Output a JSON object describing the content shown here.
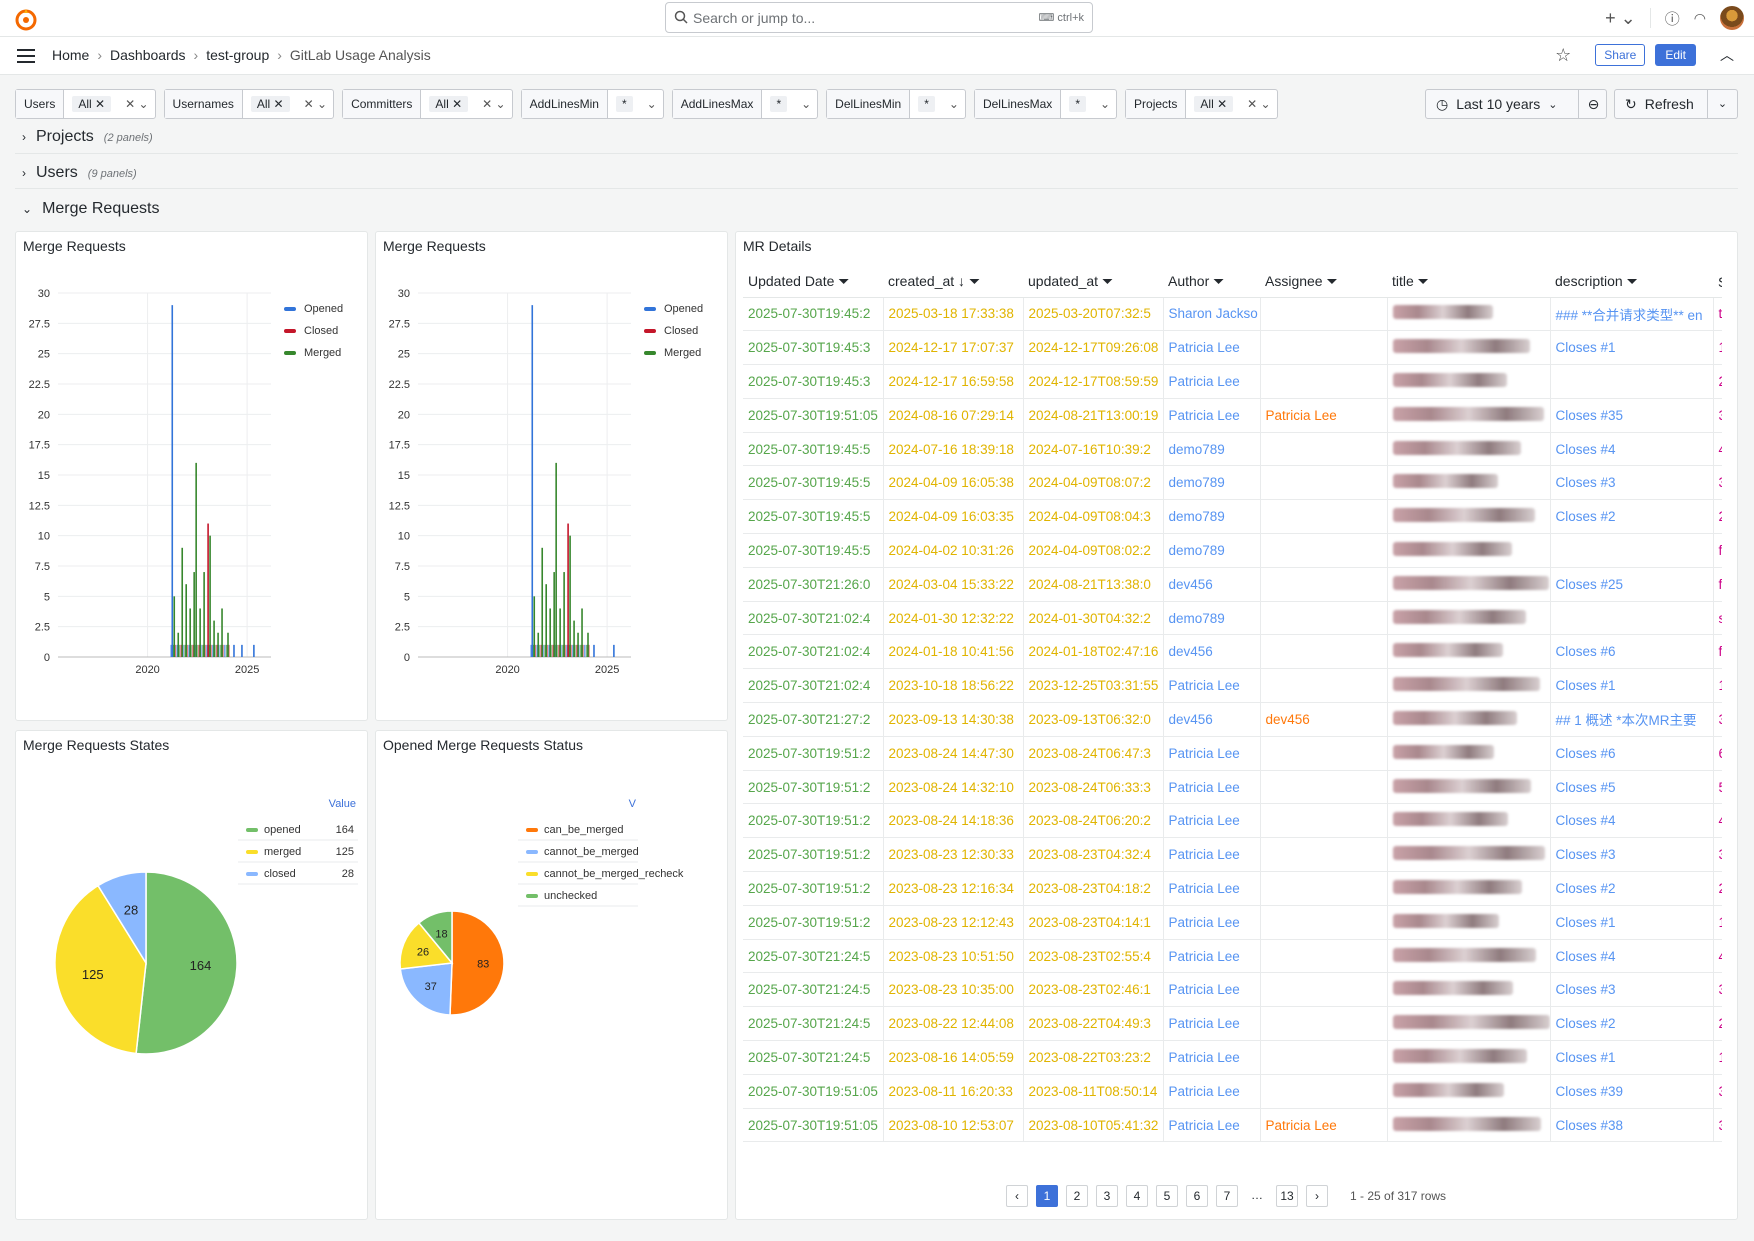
{
  "search": {
    "placeholder": "Search or jump to...",
    "shortcut": "ctrl+k"
  },
  "breadcrumbs": [
    "Home",
    "Dashboards",
    "test-group",
    "GitLab Usage Analysis"
  ],
  "toolbar": {
    "share": "Share",
    "edit": "Edit"
  },
  "variables": [
    {
      "label": "Users",
      "value": "All",
      "clearable": true
    },
    {
      "label": "Usernames",
      "value": "All",
      "clearable": true
    },
    {
      "label": "Committers",
      "value": "All",
      "clearable": true
    },
    {
      "label": "AddLinesMin",
      "value": "*",
      "clearable": false
    },
    {
      "label": "AddLinesMax",
      "value": "*",
      "clearable": false
    },
    {
      "label": "DelLinesMin",
      "value": "*",
      "clearable": false
    },
    {
      "label": "DelLinesMax",
      "value": "*",
      "clearable": false
    },
    {
      "label": "Projects",
      "value": "All",
      "clearable": true
    }
  ],
  "time": {
    "label": "Last 10 years",
    "refresh": "Refresh"
  },
  "rows": [
    {
      "title": "Projects",
      "count": "(2 panels)",
      "collapsed": true
    },
    {
      "title": "Users",
      "count": "(9 panels)",
      "collapsed": true
    },
    {
      "title": "Merge Requests",
      "collapsed": false
    }
  ],
  "panels": {
    "mr1": {
      "title": "Merge Requests"
    },
    "mr2": {
      "title": "Merge Requests"
    },
    "states": {
      "title": "Merge Requests States",
      "value_header": "Value"
    },
    "opened": {
      "title": "Opened Merge Requests Status",
      "value_header": "V"
    },
    "details": {
      "title": "MR Details"
    }
  },
  "colors": {
    "opened": "#3274d9",
    "closed": "#c4162a",
    "merged": "#37872d",
    "pie_green": "#73bf69",
    "pie_yellow": "#fade2a",
    "pie_blue": "#8ab8ff",
    "pie_orange": "#ff780a"
  },
  "chart_data": [
    {
      "type": "bar",
      "title": "Merge Requests",
      "series": [
        {
          "name": "Opened"
        },
        {
          "name": "Closed"
        },
        {
          "name": "Merged"
        }
      ],
      "yticks": [
        "0",
        "2.5",
        "5",
        "7.5",
        "10",
        "12.5",
        "15",
        "17.5",
        "20",
        "22.5",
        "25",
        "27.5",
        "30"
      ],
      "xticks": [
        "2020",
        "2025"
      ],
      "ylim": [
        0,
        30
      ],
      "bars": [
        {
          "x": 2021.2,
          "series": "Opened",
          "y": 29
        },
        {
          "x": 2021.3,
          "series": "Merged",
          "y": 5
        },
        {
          "x": 2021.5,
          "series": "Merged",
          "y": 2
        },
        {
          "x": 2021.7,
          "series": "Merged",
          "y": 9
        },
        {
          "x": 2021.9,
          "series": "Merged",
          "y": 6
        },
        {
          "x": 2022.1,
          "series": "Merged",
          "y": 4
        },
        {
          "x": 2022.3,
          "series": "Merged",
          "y": 7
        },
        {
          "x": 2022.4,
          "series": "Merged",
          "y": 16
        },
        {
          "x": 2022.6,
          "series": "Merged",
          "y": 4
        },
        {
          "x": 2022.8,
          "series": "Merged",
          "y": 7
        },
        {
          "x": 2023.0,
          "series": "Closed",
          "y": 11
        },
        {
          "x": 2023.1,
          "series": "Merged",
          "y": 10
        },
        {
          "x": 2023.3,
          "series": "Merged",
          "y": 3
        },
        {
          "x": 2023.5,
          "series": "Merged",
          "y": 2
        },
        {
          "x": 2023.7,
          "series": "Merged",
          "y": 4
        },
        {
          "x": 2024.0,
          "series": "Merged",
          "y": 2
        },
        {
          "x": 2024.3,
          "series": "Opened",
          "y": 1
        },
        {
          "x": 2024.7,
          "series": "Opened",
          "y": 1
        },
        {
          "x": 2025.3,
          "series": "Opened",
          "y": 1
        }
      ]
    },
    {
      "type": "bar",
      "title": "Merge Requests",
      "series": [
        {
          "name": "Opened"
        },
        {
          "name": "Closed"
        },
        {
          "name": "Merged"
        }
      ],
      "yticks": [
        "0",
        "2.5",
        "5",
        "7.5",
        "10",
        "12.5",
        "15",
        "17.5",
        "20",
        "22.5",
        "25",
        "27.5",
        "30"
      ],
      "xticks": [
        "2020",
        "2025"
      ],
      "ylim": [
        0,
        30
      ],
      "bars": [
        {
          "x": 2021.2,
          "series": "Opened",
          "y": 29
        },
        {
          "x": 2021.3,
          "series": "Merged",
          "y": 5
        },
        {
          "x": 2021.5,
          "series": "Merged",
          "y": 2
        },
        {
          "x": 2021.7,
          "series": "Merged",
          "y": 9
        },
        {
          "x": 2021.9,
          "series": "Merged",
          "y": 6
        },
        {
          "x": 2022.1,
          "series": "Merged",
          "y": 4
        },
        {
          "x": 2022.3,
          "series": "Merged",
          "y": 7
        },
        {
          "x": 2022.4,
          "series": "Merged",
          "y": 16
        },
        {
          "x": 2022.6,
          "series": "Merged",
          "y": 4
        },
        {
          "x": 2022.8,
          "series": "Merged",
          "y": 7
        },
        {
          "x": 2023.0,
          "series": "Closed",
          "y": 11
        },
        {
          "x": 2023.1,
          "series": "Merged",
          "y": 10
        },
        {
          "x": 2023.3,
          "series": "Merged",
          "y": 3
        },
        {
          "x": 2023.5,
          "series": "Merged",
          "y": 2
        },
        {
          "x": 2023.7,
          "series": "Merged",
          "y": 4
        },
        {
          "x": 2024.0,
          "series": "Merged",
          "y": 2
        },
        {
          "x": 2024.3,
          "series": "Opened",
          "y": 1
        },
        {
          "x": 2025.3,
          "series": "Opened",
          "y": 1
        }
      ]
    },
    {
      "type": "pie",
      "title": "Merge Requests States",
      "slices": [
        {
          "label": "opened",
          "value": 164
        },
        {
          "label": "merged",
          "value": 125
        },
        {
          "label": "closed",
          "value": 28
        }
      ]
    },
    {
      "type": "pie",
      "title": "Opened Merge Requests Status",
      "slices": [
        {
          "label": "can_be_merged",
          "value": 83
        },
        {
          "label": "cannot_be_merged",
          "value": 37
        },
        {
          "label": "cannot_be_merged_recheck",
          "value": 26
        },
        {
          "label": "unchecked",
          "value": 18
        }
      ]
    }
  ],
  "table": {
    "headers": [
      "Updated Date",
      "created_at",
      "updated_at",
      "Author",
      "Assignee",
      "title",
      "description",
      "S"
    ],
    "rows": [
      [
        "2025-07-30T19:45:2",
        "2025-03-18 17:33:38",
        "2025-03-20T07:32:5",
        "Sharon Jackso",
        "",
        "",
        "### **合并请求类型** en",
        "t"
      ],
      [
        "2025-07-30T19:45:3",
        "2024-12-17 17:07:37",
        "2024-12-17T09:26:08",
        "Patricia Lee",
        "",
        "",
        "Closes #1",
        "1"
      ],
      [
        "2025-07-30T19:45:3",
        "2024-12-17 16:59:58",
        "2024-12-17T08:59:59",
        "Patricia Lee",
        "",
        "",
        "",
        "2"
      ],
      [
        "2025-07-30T19:51:05",
        "2024-08-16 07:29:14",
        "2024-08-21T13:00:19",
        "Patricia Lee",
        "Patricia Lee",
        "",
        "Closes #35",
        "3"
      ],
      [
        "2025-07-30T19:45:5",
        "2024-07-16 18:39:18",
        "2024-07-16T10:39:2",
        "demo789",
        "",
        "",
        "Closes #4",
        "4"
      ],
      [
        "2025-07-30T19:45:5",
        "2024-04-09 16:05:38",
        "2024-04-09T08:07:2",
        "demo789",
        "",
        "",
        "Closes #3",
        "3"
      ],
      [
        "2025-07-30T19:45:5",
        "2024-04-09 16:03:35",
        "2024-04-09T08:04:3",
        "demo789",
        "",
        "",
        "Closes #2",
        "2"
      ],
      [
        "2025-07-30T19:45:5",
        "2024-04-02 10:31:26",
        "2024-04-09T08:02:2",
        "demo789",
        "",
        "",
        "",
        "f"
      ],
      [
        "2025-07-30T21:26:0",
        "2024-03-04 15:33:22",
        "2024-08-21T13:38:0",
        "dev456",
        "",
        "",
        "Closes #25",
        "f"
      ],
      [
        "2025-07-30T21:02:4",
        "2024-01-30 12:32:22",
        "2024-01-30T04:32:2",
        "demo789",
        "",
        "",
        "",
        "s"
      ],
      [
        "2025-07-30T21:02:4",
        "2024-01-18 10:41:56",
        "2024-01-18T02:47:16",
        "dev456",
        "",
        "",
        "Closes #6",
        "f"
      ],
      [
        "2025-07-30T21:02:4",
        "2023-10-18 18:56:22",
        "2023-12-25T03:31:55",
        "Patricia Lee",
        "",
        "",
        "Closes #1",
        "1"
      ],
      [
        "2025-07-30T21:27:2",
        "2023-09-13 14:30:38",
        "2023-09-13T06:32:0",
        "dev456",
        "dev456",
        "",
        "## 1 概述 *本次MR主要",
        "3"
      ],
      [
        "2025-07-30T19:51:2",
        "2023-08-24 14:47:30",
        "2023-08-24T06:47:3",
        "Patricia Lee",
        "",
        "",
        "Closes #6",
        "6"
      ],
      [
        "2025-07-30T19:51:2",
        "2023-08-24 14:32:10",
        "2023-08-24T06:33:3",
        "Patricia Lee",
        "",
        "",
        "Closes #5",
        "5"
      ],
      [
        "2025-07-30T19:51:2",
        "2023-08-24 14:18:36",
        "2023-08-24T06:20:2",
        "Patricia Lee",
        "",
        "",
        "Closes #4",
        "4"
      ],
      [
        "2025-07-30T19:51:2",
        "2023-08-23 12:30:33",
        "2023-08-23T04:32:4",
        "Patricia Lee",
        "",
        "",
        "Closes #3",
        "3"
      ],
      [
        "2025-07-30T19:51:2",
        "2023-08-23 12:16:34",
        "2023-08-23T04:18:2",
        "Patricia Lee",
        "",
        "",
        "Closes #2",
        "2"
      ],
      [
        "2025-07-30T19:51:2",
        "2023-08-23 12:12:43",
        "2023-08-23T04:14:1",
        "Patricia Lee",
        "",
        "",
        "Closes #1",
        "1"
      ],
      [
        "2025-07-30T21:24:5",
        "2023-08-23 10:51:50",
        "2023-08-23T02:55:4",
        "Patricia Lee",
        "",
        "",
        "Closes #4",
        "4"
      ],
      [
        "2025-07-30T21:24:5",
        "2023-08-23 10:35:00",
        "2023-08-23T02:46:1",
        "Patricia Lee",
        "",
        "",
        "Closes #3",
        "3"
      ],
      [
        "2025-07-30T21:24:5",
        "2023-08-22 12:44:08",
        "2023-08-22T04:49:3",
        "Patricia Lee",
        "",
        "",
        "Closes #2",
        "2"
      ],
      [
        "2025-07-30T21:24:5",
        "2023-08-16 14:05:59",
        "2023-08-22T03:23:2",
        "Patricia Lee",
        "",
        "",
        "Closes #1",
        "1"
      ],
      [
        "2025-07-30T19:51:05",
        "2023-08-11 16:20:33",
        "2023-08-11T08:50:14",
        "Patricia Lee",
        "",
        "",
        "Closes #39",
        "3"
      ],
      [
        "2025-07-30T19:51:05",
        "2023-08-10 12:53:07",
        "2023-08-10T05:41:32",
        "Patricia Lee",
        "Patricia Lee",
        "",
        "Closes #38",
        "3"
      ]
    ]
  },
  "pagination": {
    "pages": [
      "1",
      "2",
      "3",
      "4",
      "5",
      "6",
      "7",
      "…",
      "13"
    ],
    "current": "1",
    "info": "1 - 25 of 317 rows"
  }
}
